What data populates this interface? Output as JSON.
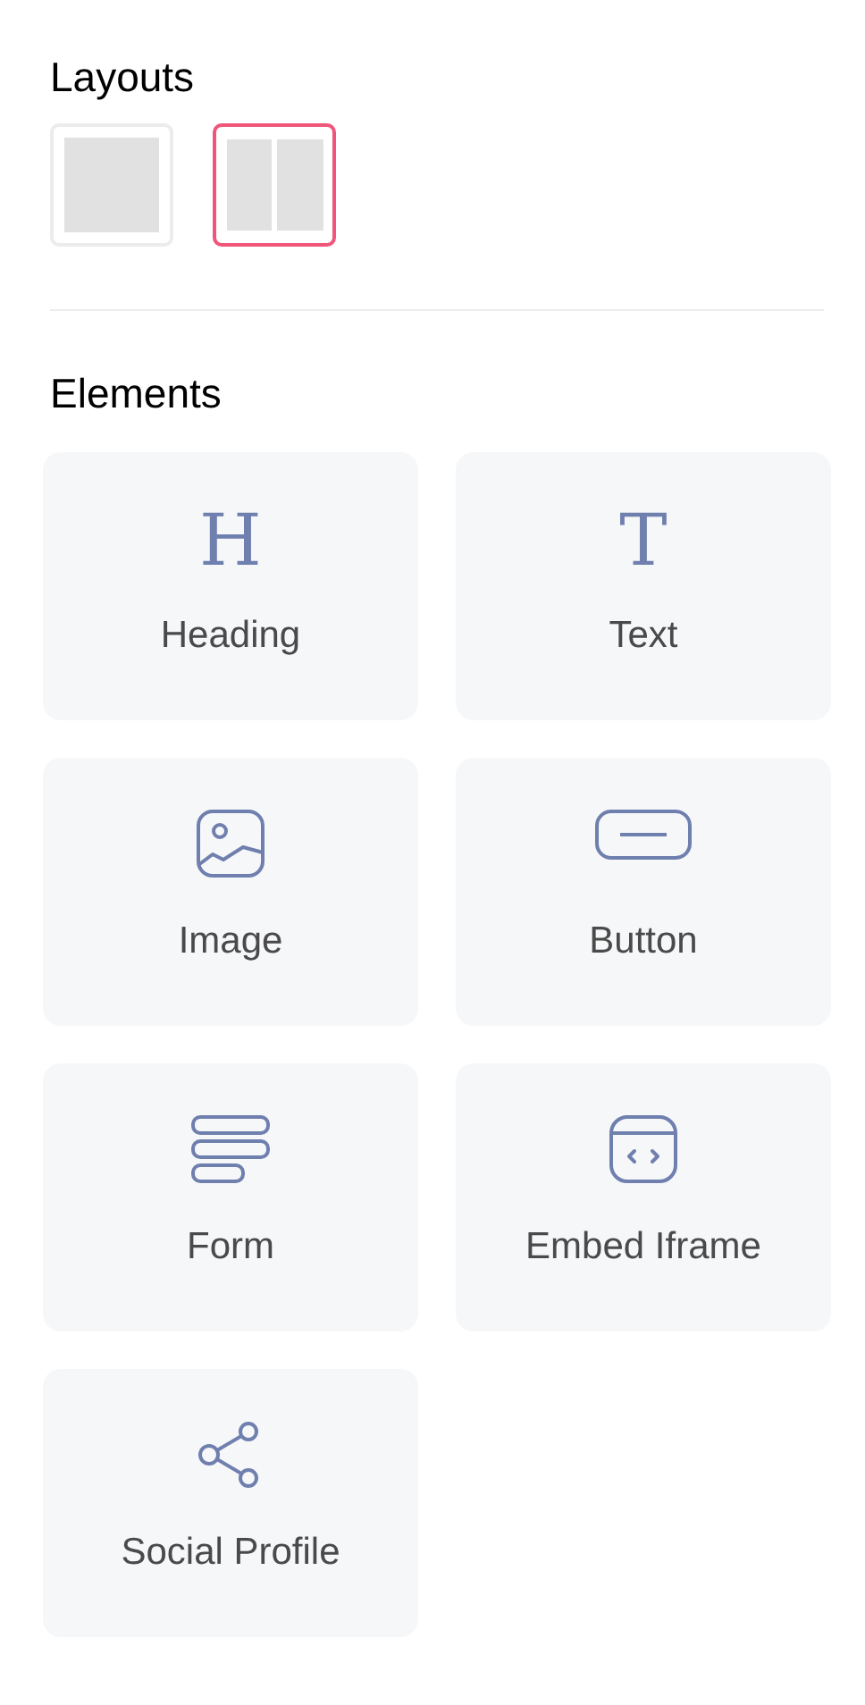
{
  "layouts": {
    "title": "Layouts",
    "options": [
      {
        "kind": "single",
        "selected": false
      },
      {
        "kind": "two-column",
        "selected": true
      }
    ]
  },
  "elements": {
    "title": "Elements",
    "items": [
      {
        "kind": "glyph",
        "glyph": "H",
        "label": "Heading"
      },
      {
        "kind": "glyph",
        "glyph": "T",
        "label": "Text"
      },
      {
        "kind": "image",
        "label": "Image"
      },
      {
        "kind": "button",
        "label": "Button"
      },
      {
        "kind": "form",
        "label": "Form"
      },
      {
        "kind": "embed",
        "label": "Embed Iframe"
      },
      {
        "kind": "share",
        "label": "Social Profile"
      }
    ]
  }
}
